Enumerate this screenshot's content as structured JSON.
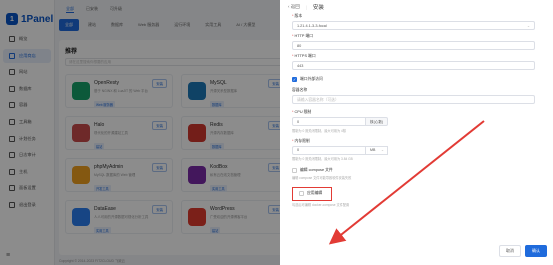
{
  "brand": {
    "logo_letter": "1",
    "name": "1Panel"
  },
  "sidebar": {
    "items": [
      {
        "label": "概览",
        "active": false
      },
      {
        "label": "应用商店",
        "active": true
      },
      {
        "label": "网站",
        "active": false
      },
      {
        "label": "数据库",
        "active": false
      },
      {
        "label": "容器",
        "active": false
      },
      {
        "label": "工具箱",
        "active": false
      },
      {
        "label": "计划任务",
        "active": false
      },
      {
        "label": "日志审计",
        "active": false
      },
      {
        "label": "主机",
        "active": false
      },
      {
        "label": "面板设置",
        "active": false
      },
      {
        "label": "退出登录",
        "active": false
      }
    ],
    "collapse_icon": "≡"
  },
  "main": {
    "top_tabs": [
      "全部",
      "已安装",
      "可升级"
    ],
    "category_tabs": [
      "全部",
      "建站",
      "数据库",
      "Web 服务器",
      "运行环境",
      "实用工具",
      "AI / 大模型"
    ],
    "panel_title": "推荐",
    "search_placeholder": "请在这里搜索你想要的应用",
    "apps": [
      {
        "name": "OpenResty",
        "desc": "基于 NGINX 和 LuaJIT 的 Web 平台",
        "tag": "Web 服务器",
        "action": "安装",
        "color": "#16a36b"
      },
      {
        "name": "MySQL",
        "desc": "开源关系型数据库",
        "tag": "数据库",
        "action": "安装",
        "color": "#1d78b8"
      },
      {
        "name": "Halo",
        "desc": "现代化的开源建站工具",
        "tag": "建站",
        "action": "安装",
        "color": "#c94b4b"
      },
      {
        "name": "Redis",
        "desc": "开源内存数据库",
        "tag": "数据库",
        "action": "安装",
        "color": "#d2372e"
      },
      {
        "name": "phpMyAdmin",
        "desc": "MySQL 数据库的 Web 管理",
        "tag": "开发工具",
        "action": "安装",
        "color": "#f0a020"
      },
      {
        "name": "KodBox",
        "desc": "私有云在线文档管理",
        "tag": "实用工具",
        "action": "安装",
        "color": "#7a2aa8"
      },
      {
        "name": "DataEase",
        "desc": "人人可用的开源数据可视化分析工具",
        "tag": "实用工具",
        "action": "安装",
        "color": "#2a7ff0"
      },
      {
        "name": "WordPress",
        "desc": "广受欢迎的开源博客平台",
        "tag": "建站",
        "action": "安装",
        "color": "#e03b2f"
      }
    ],
    "footer": "Copyright © 2014-2023 FIT2CLOUD 飞致云"
  },
  "drawer": {
    "back_label": "返回",
    "title": "安装",
    "fields": {
      "version_label": "版本",
      "version_value": "1.21.4.1-3-3-focal",
      "http_port_label": "HTTP 端口",
      "http_port_value": "80",
      "https_port_label": "HTTPS 端口",
      "https_port_value": "443",
      "port_external_label": "端口外部访问",
      "container_name_label": "容器名称",
      "container_name_placeholder": "请输入容器名称（可选）",
      "cpu_label": "CPU 限制",
      "cpu_value": "0",
      "cpu_unit": "核(心数)",
      "cpu_hint": "限制为 0 则关闭限制，最大可用为 4核",
      "mem_label": "内存限制",
      "mem_value": "0",
      "mem_unit": "MB",
      "mem_hint": "限制为 0 则关闭限制，最大可用为 3.84 GB",
      "compose_label": "编辑 compose 文件",
      "compose_hint": "编辑 compose 文件可能导致软件安装失败",
      "edit_label": "应用编辑",
      "edit_hint": "勾选后可编辑 docker-compose 文件配置"
    },
    "cancel_label": "取消",
    "confirm_label": "确认"
  },
  "annotation": {
    "arrow_color": "#e23b35"
  }
}
